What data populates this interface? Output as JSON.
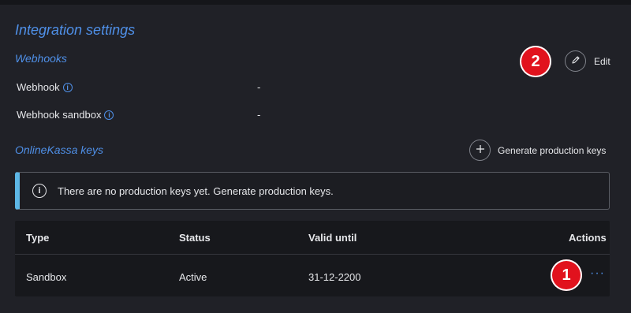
{
  "page": {
    "title": "Integration settings"
  },
  "webhooks": {
    "section_title": "Webhooks",
    "edit_label": "Edit",
    "rows": [
      {
        "label": "Webhook",
        "value": "-"
      },
      {
        "label": "Webhook sandbox",
        "value": "-"
      }
    ]
  },
  "keys": {
    "section_title": "OnlineKassa keys",
    "generate_label": "Generate production keys",
    "alert_text": "There are no production keys yet. Generate production keys."
  },
  "table": {
    "headers": [
      "Type",
      "Status",
      "Valid until",
      "Actions"
    ],
    "rows": [
      {
        "type": "Sandbox",
        "status": "Active",
        "valid_until": "31-12-2200",
        "actions": "···"
      }
    ]
  },
  "annotations": {
    "badge_1": "1",
    "badge_2": "2"
  },
  "colors": {
    "accent": "#4f90e8",
    "badge": "#e1121d",
    "alert_border": "#5db7e6",
    "background": "#202127"
  },
  "icons": {
    "edit": "pencil-icon",
    "generate": "plus-icon",
    "info": "info-icon",
    "actions": "more-dots-icon"
  }
}
